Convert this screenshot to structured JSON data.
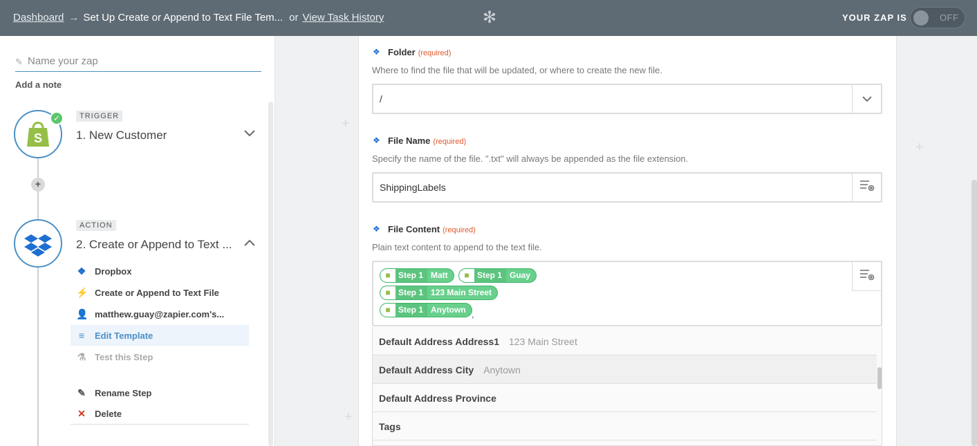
{
  "topbar": {
    "dashboard_link": "Dashboard",
    "arrow": "→",
    "title": "Set Up Create or Append to Text File Tem...",
    "or": "or",
    "history_link": "View Task History",
    "zap_label": "YOUR ZAP IS",
    "toggle_state": "OFF"
  },
  "left": {
    "name_placeholder": "Name your zap",
    "add_note": "Add a note",
    "steps": [
      {
        "tag": "TRIGGER",
        "name": "1. New Customer",
        "complete": true
      },
      {
        "tag": "ACTION",
        "name": "2. Create or Append to Text ..."
      }
    ],
    "substeps": [
      {
        "icon": "dropbox-icon",
        "label": "Dropbox"
      },
      {
        "icon": "bolt-icon",
        "label": "Create or Append to Text File"
      },
      {
        "icon": "user-icon",
        "label": "matthew.guay@zapier.com's..."
      },
      {
        "icon": "list-icon",
        "label": "Edit Template",
        "active": true
      },
      {
        "icon": "flask-icon",
        "label": "Test this Step",
        "muted": true
      },
      {
        "icon": "pencil-icon",
        "label": "Rename Step"
      },
      {
        "icon": "close-icon",
        "label": "Delete"
      }
    ]
  },
  "form": {
    "folder": {
      "label": "Folder",
      "required": "(required)",
      "help": "Where to find the file that will be updated, or where to create the new file.",
      "value": "/"
    },
    "file_name": {
      "label": "File Name",
      "required": "(required)",
      "help": "Specify the name of the file. \".txt\" will always be appended as the file extension.",
      "value": "ShippingLabels"
    },
    "file_content": {
      "label": "File Content",
      "required": "(required)",
      "help": "Plain text content to append to the text file.",
      "pills": [
        {
          "step": "Step 1",
          "value": "Matt"
        },
        {
          "step": "Step 1",
          "value": "Guay"
        },
        {
          "step": "Step 1",
          "value": "123 Main Street"
        },
        {
          "step": "Step 1",
          "value": "Anytown"
        }
      ],
      "trailing_text": ","
    },
    "dropdown": [
      {
        "key": "Default Address Address1",
        "value": "123 Main Street"
      },
      {
        "key": "Default Address City",
        "value": "Anytown",
        "highlighted": true
      },
      {
        "key": "Default Address Province",
        "value": ""
      },
      {
        "key": "Tags",
        "value": ""
      }
    ]
  },
  "colors": {
    "topbar": "#5f6b74",
    "accent": "#4a90c6",
    "required": "#e0582a",
    "pill": "#68d08c",
    "success": "#5bc76b"
  }
}
